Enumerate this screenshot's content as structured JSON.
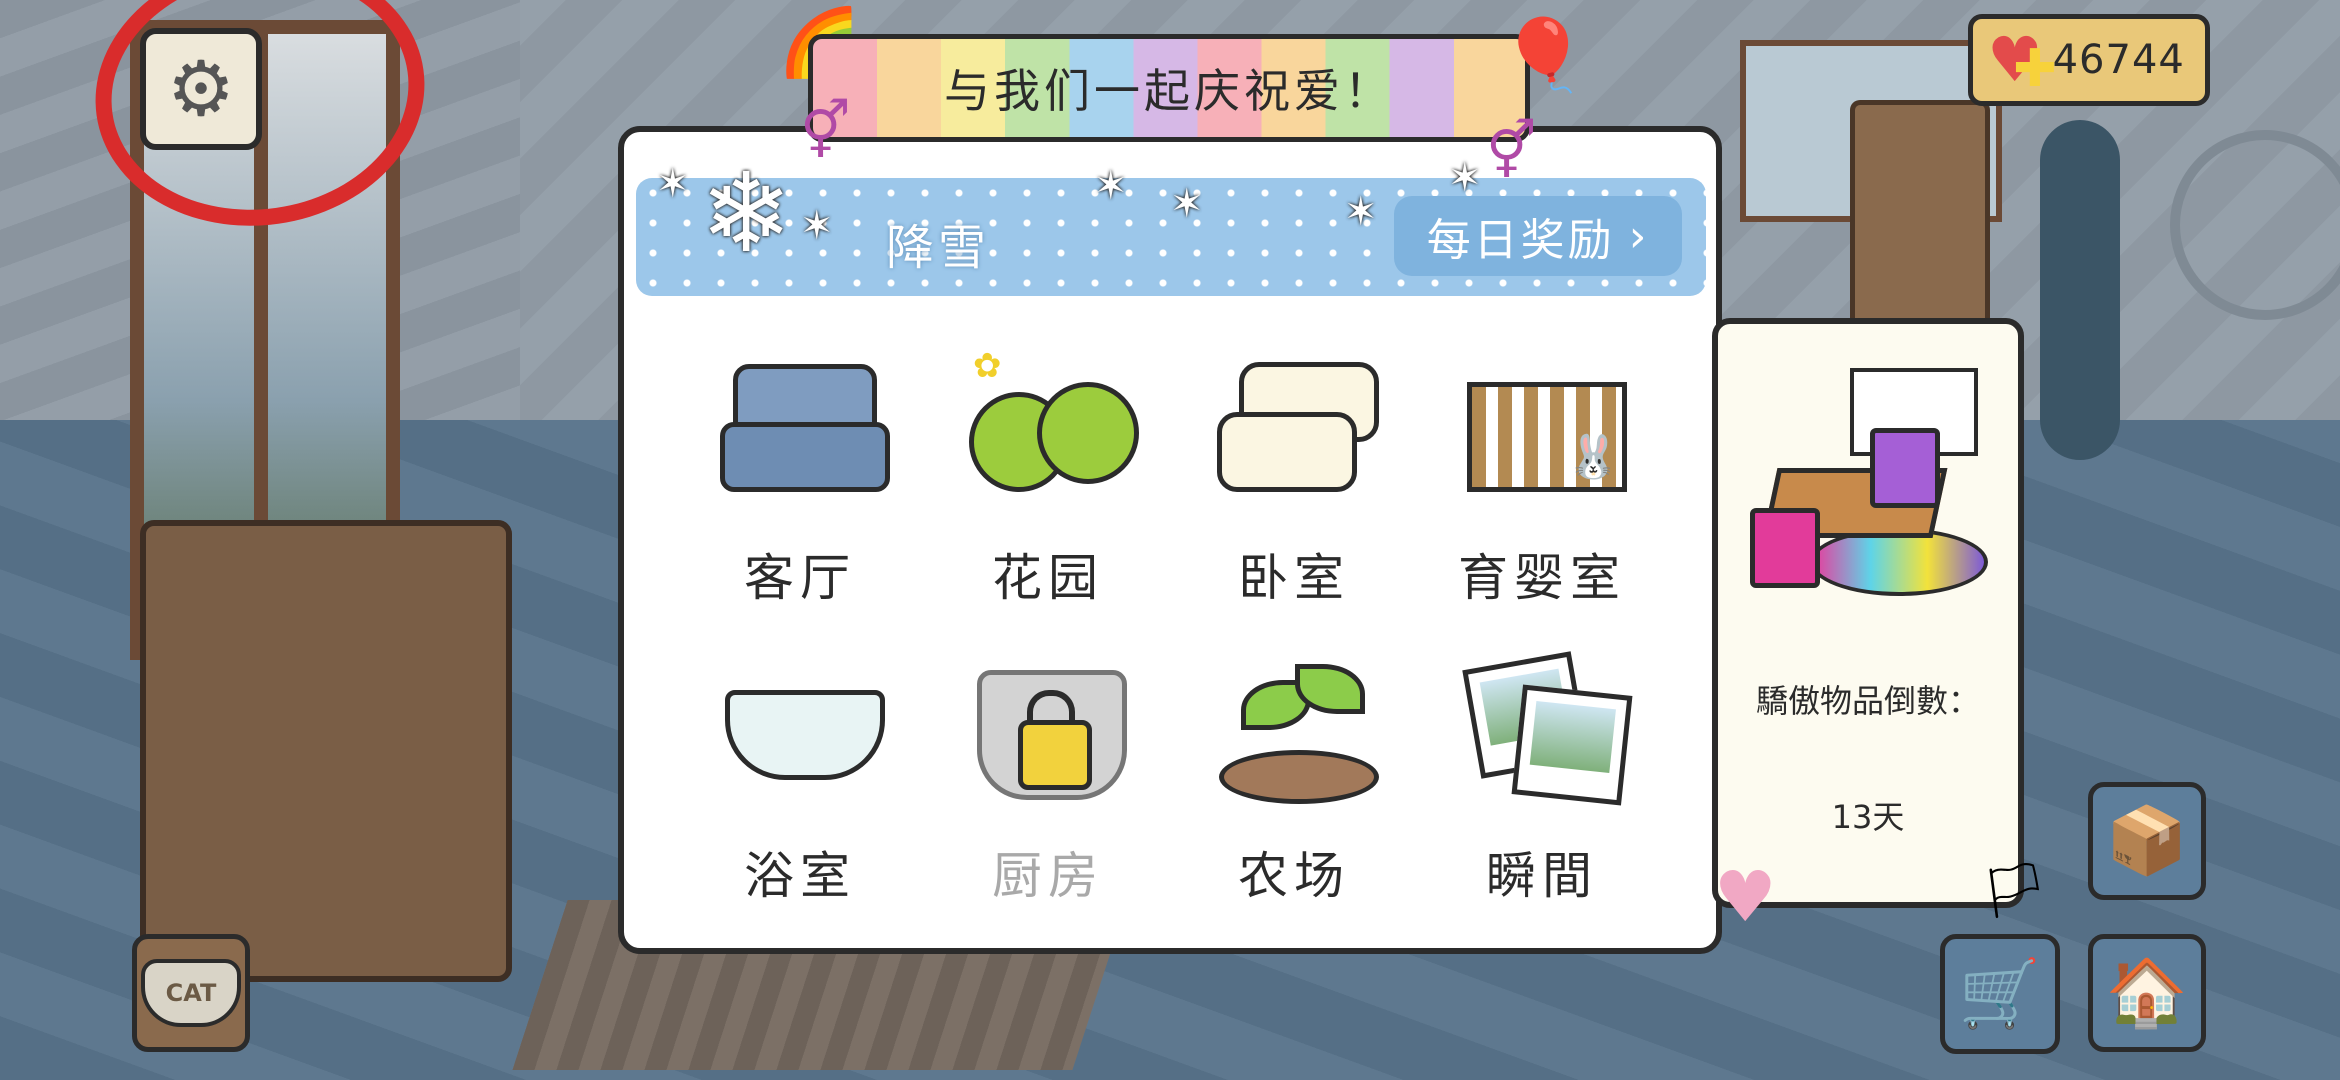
{
  "header": {
    "event_title": "与我们一起庆祝爱！",
    "heart_count": "46744"
  },
  "weather": {
    "label": "降雪",
    "daily_reward_label": "每日奖励",
    "chevron": "›"
  },
  "rooms": [
    {
      "label": "客厅",
      "icon": "sofa-icon",
      "locked": false
    },
    {
      "label": "花园",
      "icon": "garden-icon",
      "locked": false
    },
    {
      "label": "卧室",
      "icon": "pillows-icon",
      "locked": false
    },
    {
      "label": "育婴室",
      "icon": "crib-icon",
      "locked": false
    },
    {
      "label": "浴室",
      "icon": "bathtub-icon",
      "locked": false
    },
    {
      "label": "厨房",
      "icon": "locked-pot-icon",
      "locked": true
    },
    {
      "label": "农场",
      "icon": "sprout-icon",
      "locked": false
    },
    {
      "label": "瞬間",
      "icon": "photos-icon",
      "locked": false
    }
  ],
  "side_panel": {
    "countdown_label": "驕傲物品倒數：",
    "countdown_value": "13天"
  },
  "cat_bowl": {
    "text": "CAT"
  },
  "glyphs": {
    "gear": "⚙",
    "heart": "♥",
    "plus": "✚",
    "snowflake": "❄",
    "star": "✶",
    "gender": "⚥",
    "balloon": "🎈",
    "rainbow": "🌈",
    "box": "📦",
    "cart": "🛒",
    "house": "🏠",
    "butterfly": "✿",
    "bunny": "🐰",
    "heart_deco": "♥",
    "pride_flag": "🏳"
  },
  "colors": {
    "highlight_circle": "#d92c2c",
    "snow_banner": "#9cc7ea",
    "reward_button": "#7fb3de",
    "heart_counter_bg": "#e9c879",
    "locked_text": "#a9a9a9"
  }
}
